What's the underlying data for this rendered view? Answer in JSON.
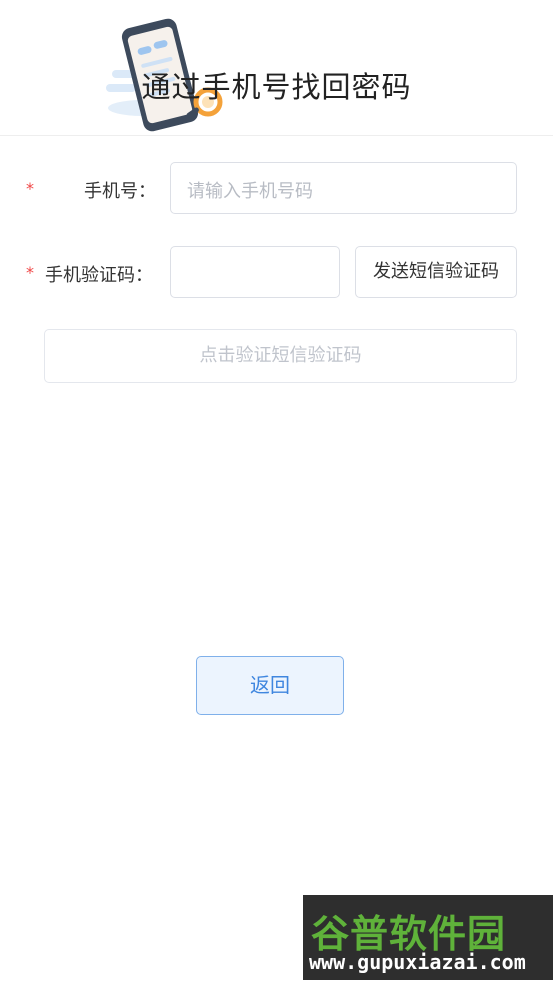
{
  "header": {
    "title": "通过手机号找回密码",
    "illustration_icon": "phone-illustration-icon"
  },
  "form": {
    "required_mark": "*",
    "phone": {
      "label": "手机号：",
      "placeholder": "请输入手机号码",
      "value": ""
    },
    "sms_code": {
      "label": "手机验证码：",
      "value": "",
      "send_button_label": "发送短信验证码"
    },
    "verify_button_label": "点击验证短信验证码"
  },
  "back_button_label": "返回",
  "watermark": {
    "logo_text": "谷普软件园",
    "url_text": "www.gupuxiazai.com"
  },
  "colors": {
    "required": "#f04545",
    "accent": "#3f86df",
    "accent_bg": "#ecf4fe",
    "border": "#dcdfe6",
    "placeholder": "#b8bcc4"
  }
}
